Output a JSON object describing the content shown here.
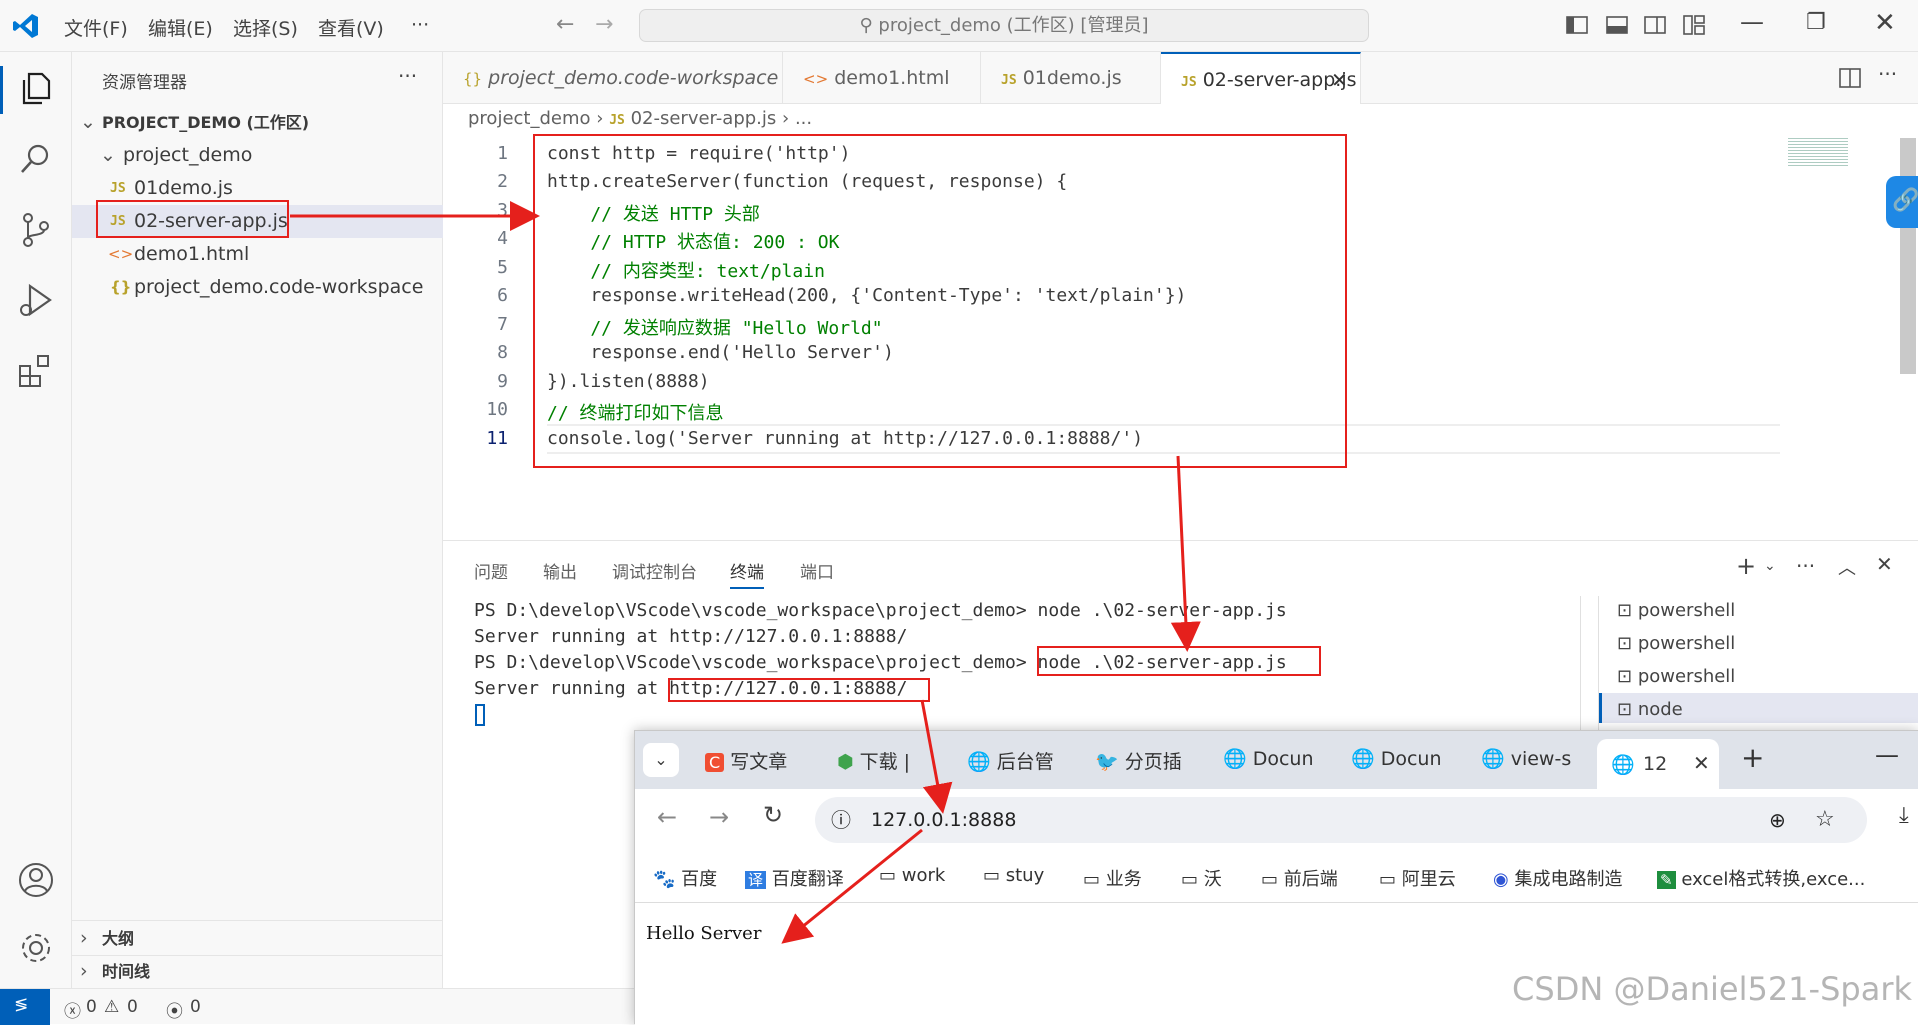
{
  "titlebar": {
    "menus": [
      "文件(F)",
      "编辑(E)",
      "选择(S)",
      "查看(V)",
      "···"
    ],
    "command_center": "project_demo (工作区) [管理员]"
  },
  "sidebar": {
    "title": "资源管理器",
    "more": "···",
    "workspace": "PROJECT_DEMO (工作区)",
    "folder": "project_demo",
    "files": [
      "01demo.js",
      "02-server-app.js",
      "demo1.html",
      "project_demo.code-workspace"
    ],
    "outline": "大纲",
    "timeline": "时间线"
  },
  "tabs": [
    "project_demo.code-workspace",
    "demo1.html",
    "01demo.js",
    "02-server-app.js"
  ],
  "breadcrumb": {
    "folder": "project_demo",
    "file": "02-server-app.js",
    "rest": "..."
  },
  "code": {
    "line_numbers": [
      "1",
      "2",
      "3",
      "4",
      "5",
      "6",
      "7",
      "8",
      "9",
      "10",
      "11"
    ],
    "lines": [
      "const http = require('http')",
      "http.createServer(function (request, response) {",
      "    // 发送 HTTP 头部",
      "    // HTTP 状态值: 200 : OK",
      "    // 内容类型: text/plain",
      "    response.writeHead(200, {'Content-Type': 'text/plain'})",
      "    // 发送响应数据 \"Hello World\"",
      "    response.end('Hello Server')",
      "}).listen(8888)",
      "// 终端打印如下信息",
      "console.log('Server running at http://127.0.0.1:8888/')"
    ]
  },
  "panel": {
    "tabs": [
      "问题",
      "输出",
      "调试控制台",
      "终端",
      "端口"
    ],
    "terminal_lines": [
      "PS D:\\develop\\VScode\\vscode_workspace\\project_demo> node .\\02-server-app.js",
      "Server running at http://127.0.0.1:8888/",
      "PS D:\\develop\\VScode\\vscode_workspace\\project_demo> node .\\02-server-app.js",
      "Server running at http://127.0.0.1:8888/"
    ],
    "terminal_list": [
      "powershell",
      "powershell",
      "powershell",
      "node"
    ]
  },
  "statusbar": {
    "errors": "0",
    "warnings": "0",
    "ports": "0"
  },
  "browser": {
    "tabs": [
      "写文章",
      "下载 |",
      "后台管",
      "分页插",
      "Docun",
      "Docun",
      "view-s",
      "12"
    ],
    "address": "127.0.0.1:8888",
    "bookmarks": [
      "百度",
      "百度翻译",
      "work",
      "stuy",
      "业务",
      "沃",
      "前后端",
      "阿里云",
      "集成电路制造",
      "excel格式转换,exce..."
    ],
    "content": "Hello Server"
  },
  "watermark": "CSDN @Daniel521-Spark",
  "colors": {
    "accent": "#005fb8",
    "annotation_red": "#e5201c"
  }
}
